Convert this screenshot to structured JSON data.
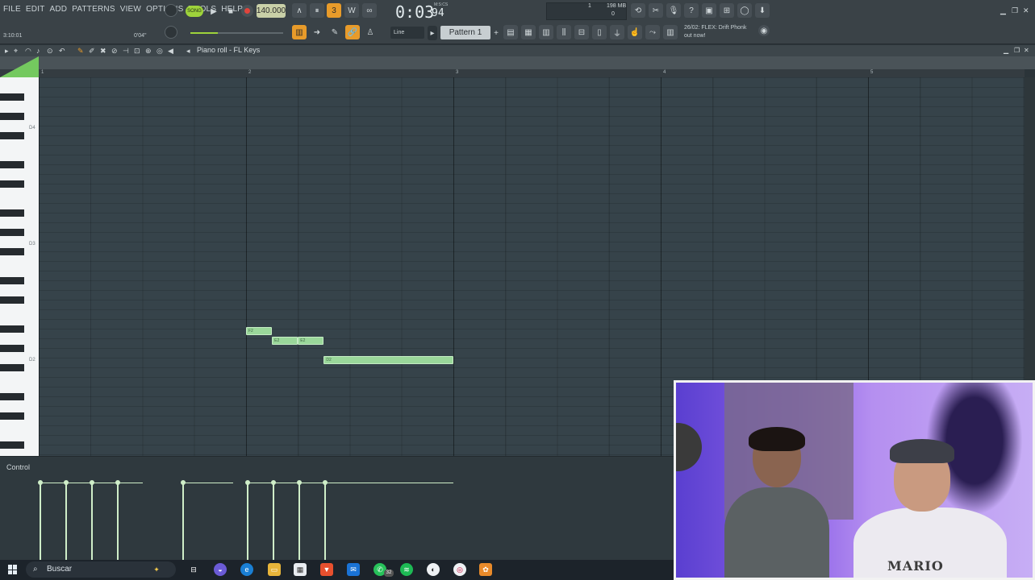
{
  "menu": [
    "FILE",
    "EDIT",
    "ADD",
    "PATTERNS",
    "VIEW",
    "OPTIONS",
    "TOOLS",
    "HELP"
  ],
  "transport": {
    "mode_label": "SONG",
    "tempo": "140.000",
    "time": "0:03",
    "time_fraction": "94",
    "time_unit": "M:S:CS",
    "counter_left": "3:10:01",
    "counter_right": "0'04\""
  },
  "monitor": {
    "cpu": "1",
    "memory": "198 MB",
    "voices": "0"
  },
  "toolbar": {
    "snap_mode": "Line",
    "pattern_name": "Pattern 1"
  },
  "news": {
    "line1": "26/02: FLEX: Drift Phonk",
    "line2": "out now!"
  },
  "piano_roll": {
    "title": "Piano roll - FL Keys",
    "ruler": [
      "1",
      "2",
      "3",
      "4",
      "5"
    ],
    "key_labels": [
      "D4",
      "D3",
      "D2"
    ],
    "notes": [
      {
        "label": "F2",
        "start_beat": 4.0,
        "length_beats": 0.5,
        "pitch": "F2"
      },
      {
        "label": "E2",
        "start_beat": 4.5,
        "length_beats": 0.5,
        "pitch": "E2"
      },
      {
        "label": "E2",
        "start_beat": 5.0,
        "length_beats": 0.5,
        "pitch": "E2"
      },
      {
        "label": "D2",
        "start_beat": 5.5,
        "length_beats": 2.5,
        "pitch": "D2"
      }
    ],
    "control_label": "Control",
    "velocity_beats": [
      0.0,
      0.5,
      1.0,
      1.5,
      2.75,
      4.0,
      4.5,
      5.0,
      5.5
    ]
  },
  "taskbar": {
    "search_placeholder": "Buscar",
    "whatsapp_badge": "32"
  },
  "webcam": {
    "shirt_text": "MARIO"
  },
  "colors": {
    "accent_green": "#9ed33b",
    "note_fill": "#9ad79a",
    "grid_bg": "#36434a",
    "highlight_orange": "#e89b2a"
  }
}
